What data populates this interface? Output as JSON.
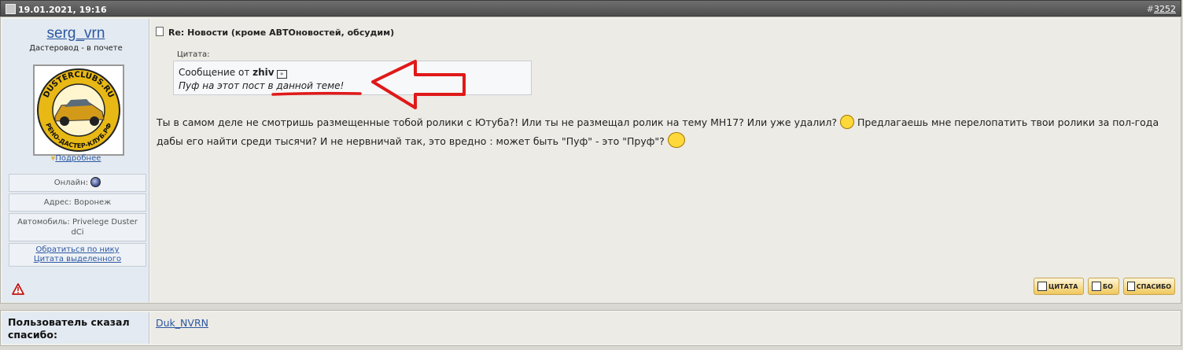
{
  "post": {
    "date": "19.01.2021, 19:16",
    "number_prefix": "#",
    "number": "3252",
    "title": "Re: Новости (кроме АВТОновостей, обсудим)"
  },
  "user": {
    "name": "serg_vrn",
    "title": "Дастеровод - в почете",
    "avatar_text_top": "DUSTERCLUBS.RU",
    "avatar_text_bottom": "РЕНО-ДАСТЕР-КЛУБ.РФ",
    "more_link": "Подробнее",
    "online_label": "Онлайн:",
    "address": "Адрес: Воронеж",
    "car": "Автомобиль: Privelege Duster dCi",
    "link_nick": "Обратиться по нику",
    "link_quote": "Цитата выделенного"
  },
  "quote": {
    "label": "Цитата:",
    "from_prefix": "Сообщение от",
    "author": "zhiv",
    "text": "Пуф на этот пост в данной теме!"
  },
  "message": {
    "part1": "Ты в самом деле не смотришь размещенные тобой ролики с Ютуба?! Или ты не размещал ролик на тему MH17? Или уже удалил?",
    "part2": "Предлагаешь мне перелопатить твои ролики за пол-года дабы его найти среди тысячи? И не нервничай так, это вредно : может быть \"Пуф\" - это \"Пруф\"?"
  },
  "buttons": {
    "quote": "ЦИТАТА",
    "multi": "БО",
    "thanks": "СПАСИБО"
  },
  "thanks": {
    "label": "Пользователь сказал спасибо:",
    "user": "Duk_NVRN"
  },
  "colors": {
    "link": "#2c57a2",
    "annotation": "#e01919",
    "header_bg": "#5a5a5a"
  },
  "icons": [
    "post-icon",
    "view-post-icon",
    "online-status-icon",
    "warning-icon",
    "laughing-smiley-icon",
    "waving-smiley-icon",
    "quote-icon",
    "multiquote-icon",
    "thanks-icon"
  ]
}
